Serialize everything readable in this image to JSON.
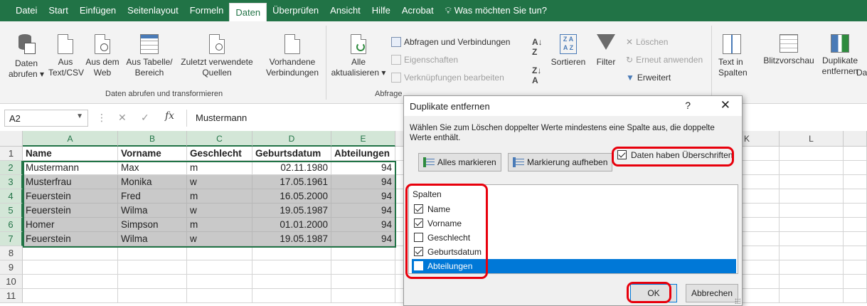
{
  "tabs": [
    "Datei",
    "Start",
    "Einfügen",
    "Seitenlayout",
    "Formeln",
    "Daten",
    "Überprüfen",
    "Ansicht",
    "Hilfe",
    "Acrobat"
  ],
  "active_tab": "Daten",
  "tellme": "Was möchten Sie tun?",
  "ribbon": {
    "get_data": [
      "Daten",
      "abrufen ▾"
    ],
    "text_csv": [
      "Aus",
      "Text/CSV"
    ],
    "web": [
      "Aus dem",
      "Web"
    ],
    "table": [
      "Aus Tabelle/",
      "Bereich"
    ],
    "recent": [
      "Zuletzt verwendete",
      "Quellen"
    ],
    "existing": [
      "Vorhandene",
      "Verbindungen"
    ],
    "group_get": "Daten abrufen und transformieren",
    "refresh": [
      "Alle",
      "aktualisieren ▾"
    ],
    "queries": "Abfragen und Verbindungen",
    "properties": "Eigenschaften",
    "links": "Verknüpfungen bearbeiten",
    "group_queries": "Abfrage",
    "sort_label": "Sortieren",
    "filter_label": "Filter",
    "clear": "Löschen",
    "reapply": "Erneut anwenden",
    "advanced": "Erweitert",
    "text_to_cols": [
      "Text in",
      "Spalten"
    ],
    "flash_fill": "Blitzvorschau",
    "remove_dup": [
      "Duplikate",
      "entfernen"
    ],
    "cut_off": "Dat"
  },
  "formula_bar": {
    "namebox": "A2",
    "fx": "fx",
    "content": "Mustermann"
  },
  "columns": [
    "A",
    "B",
    "C",
    "D",
    "E",
    "K",
    "L"
  ],
  "rows": [
    "1",
    "2",
    "3",
    "4",
    "5",
    "6",
    "7",
    "8",
    "9",
    "10",
    "11"
  ],
  "table": {
    "headers": [
      "Name",
      "Vorname",
      "Geschlecht",
      "Geburtsdatum",
      "Abteilungen"
    ],
    "data": [
      [
        "Mustermann",
        "Max",
        "m",
        "02.11.1980",
        "94"
      ],
      [
        "Musterfrau",
        "Monika",
        "w",
        "17.05.1961",
        "94"
      ],
      [
        "Feuerstein",
        "Fred",
        "m",
        "16.05.2000",
        "94"
      ],
      [
        "Feuerstein",
        "Wilma",
        "w",
        "19.05.1987",
        "94"
      ],
      [
        "Homer",
        "Simpson",
        "m",
        "01.01.2000",
        "94"
      ],
      [
        "Feuerstein",
        "Wilma",
        "w",
        "19.05.1987",
        "94"
      ]
    ]
  },
  "dialog": {
    "title": "Duplikate entfernen",
    "help": "?",
    "close": "✕",
    "message": "Wählen Sie zum Löschen doppelter Werte mindestens eine Spalte aus, die doppelte Werte enthält.",
    "select_all": "Alles markieren",
    "unselect_all": "Markierung aufheben",
    "has_headers": "Daten haben Überschriften",
    "columns_label": "Spalten",
    "columns": [
      {
        "label": "Name",
        "checked": true
      },
      {
        "label": "Vorname",
        "checked": true
      },
      {
        "label": "Geschlecht",
        "checked": false
      },
      {
        "label": "Geburtsdatum",
        "checked": true
      },
      {
        "label": "Abteilungen",
        "checked": false
      }
    ],
    "ok": "OK",
    "cancel": "Abbrechen"
  },
  "colors": {
    "excel_green": "#217346",
    "highlight_red": "#e8000c",
    "selection_blue": "#0078d7"
  }
}
